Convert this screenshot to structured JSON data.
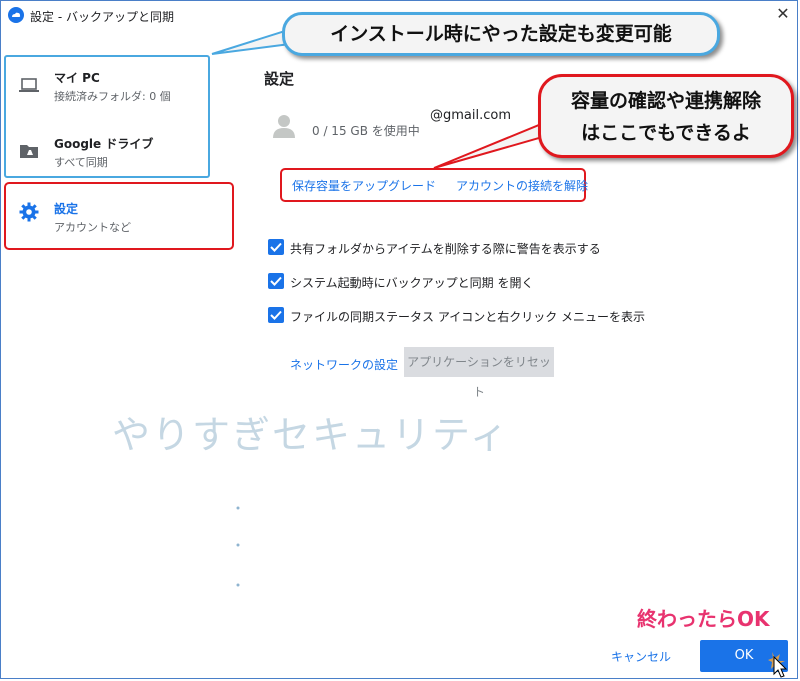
{
  "window": {
    "title": "設定 - バックアップと同期",
    "close_symbol": "✕"
  },
  "sidebar": {
    "items": [
      {
        "title": "マイ PC",
        "subtitle": "接続済みフォルダ: 0 個",
        "icon": "laptop-icon"
      },
      {
        "title": "Google ドライブ",
        "subtitle": "すべて同期",
        "icon": "drive-folder-icon"
      },
      {
        "title": "設定",
        "subtitle": "アカウントなど",
        "icon": "gear-icon"
      }
    ]
  },
  "callouts": {
    "blue": "インストール時にやった設定も変更可能",
    "red_line1": "容量の確認や連携解除",
    "red_line2": "はここでもできるよ"
  },
  "settings": {
    "section_title": "設定",
    "account_email": "@gmail.com",
    "usage": "0 / 15 GB を使用中",
    "upgrade_link": "保存容量をアップグレード",
    "disconnect_link": "アカウントの接続を解除",
    "checkboxes": [
      {
        "label": "共有フォルダからアイテムを削除する際に警告を表示する",
        "checked": true
      },
      {
        "label": "システム起動時にバックアップと同期 を開く",
        "checked": true
      },
      {
        "label": "ファイルの同期ステータス アイコンと右クリック メニューを表示",
        "checked": true
      }
    ],
    "network_link": "ネットワークの設定",
    "reset_button": "アプリケーションをリセット"
  },
  "watermark": "やりすぎセキュリティ",
  "footer": {
    "done_note": "終わったらOK",
    "cancel": "キャンセル",
    "ok": "OK"
  },
  "colors": {
    "accent": "#1a73e8",
    "callout_blue": "#4aa8e0",
    "callout_red": "#e0181e",
    "note_pink": "#e8336f"
  }
}
